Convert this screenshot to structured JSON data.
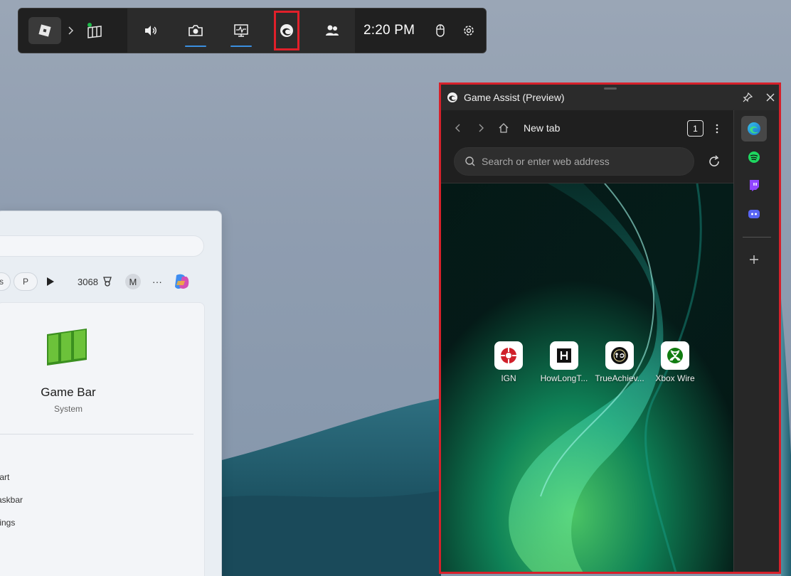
{
  "gamebar": {
    "time": "2:20 PM",
    "icons": [
      "roblox-icon",
      "chevron-right-icon",
      "widget-menu-icon",
      "volume-icon",
      "capture-icon",
      "performance-icon",
      "edge-game-assist-icon",
      "social-icon",
      "mouse-icon",
      "settings-icon"
    ]
  },
  "startmenu": {
    "pill_1": "s",
    "pill_2": "P",
    "points": "3068",
    "avatar_initial": "M",
    "more": "···",
    "app_name": "Game Bar",
    "app_subtitle": "System",
    "options": [
      "tart",
      "askbar",
      "tings"
    ]
  },
  "panel": {
    "title": "Game Assist (Preview)",
    "tab_title": "New tab",
    "tab_count": "1",
    "search_placeholder": "Search or enter web address",
    "tiles": [
      {
        "label": "IGN",
        "icon": "ign-icon"
      },
      {
        "label": "HowLongT...",
        "icon": "howlongtobeat-icon"
      },
      {
        "label": "TrueAchiev...",
        "icon": "trueachievements-icon"
      },
      {
        "label": "Xbox Wire",
        "icon": "xbox-icon"
      }
    ],
    "widgets": [
      "edge-icon",
      "spotify-icon",
      "twitch-icon",
      "discord-icon",
      "add-icon"
    ]
  },
  "colors": {
    "highlight": "#d6202a",
    "accent": "#3b8fe0"
  }
}
